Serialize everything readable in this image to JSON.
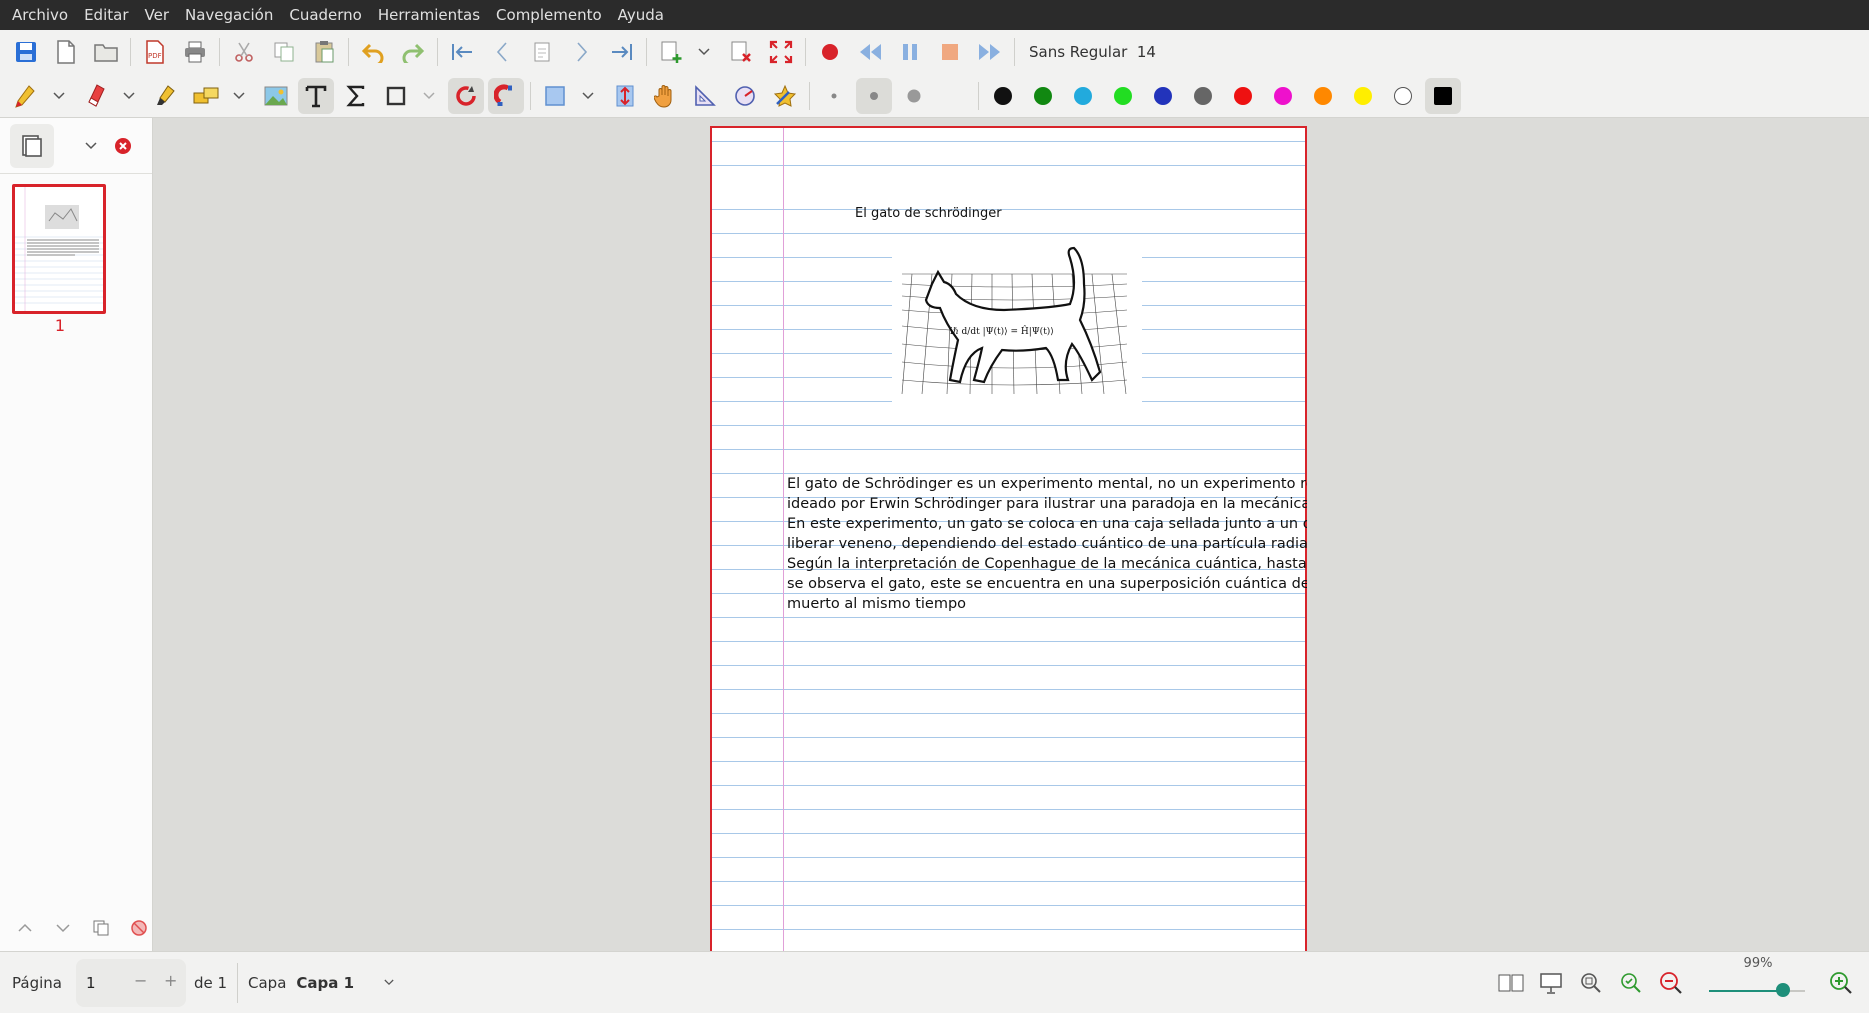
{
  "menu": [
    "Archivo",
    "Editar",
    "Ver",
    "Navegación",
    "Cuaderno",
    "Herramientas",
    "Complemento",
    "Ayuda"
  ],
  "toolbar": {
    "font_name": "Sans Regular",
    "font_size": "14"
  },
  "colors": {
    "accent": "#d8232a",
    "slider": "#1e8f7a",
    "ruled_line": "#a8c8e8",
    "margin_line": "#e0a0d8"
  },
  "palette": [
    "#111111",
    "#118811",
    "#22aadd",
    "#22dd22",
    "#2233bb",
    "#666666",
    "#ee1111",
    "#ee11cc",
    "#ff8800",
    "#ffee00",
    "#ffffff",
    "#000000"
  ],
  "sidebar": {
    "thumb_page": "1"
  },
  "page": {
    "title": "El gato de schrödinger",
    "formula": "iℏ d/dt |Ψ(t)⟩ = Ĥ|Ψ(t)⟩",
    "lines": [
      "El gato de Schrödinger es un experimento mental, no un experimento real,",
      "ideado por Erwin Schrödinger para ilustrar una paradoja en la mecánica cuántica.",
      "En este experimento, un gato se coloca en una caja sellada junto a un dispositivo",
      "liberar veneno, dependiendo del estado cuántico de una partícula radiactiva.",
      "Según la interpretación de Copenhague de la mecánica cuántica, hasta que se abre",
      "se observa el gato, este se encuentra en una superposición cuántica de estar",
      "muerto al mismo tiempo"
    ]
  },
  "status": {
    "page_label": "Página",
    "page_value": "1",
    "of_label": "de 1",
    "layer_label": "Capa",
    "layer_value": "Capa 1",
    "zoom": "99%",
    "zoom_fraction": 0.99
  }
}
